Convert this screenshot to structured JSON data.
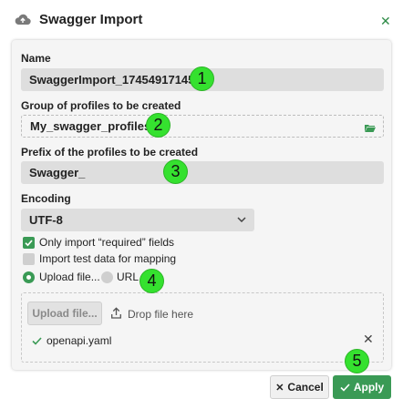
{
  "dialog": {
    "title": "Swagger Import",
    "close_icon": "close-icon",
    "title_icon": "cloud-upload-icon"
  },
  "form": {
    "name": {
      "label": "Name",
      "value": "SwaggerImport_1745491714574"
    },
    "group": {
      "label": "Group of profiles to be created",
      "value": "My_swagger_profiles",
      "icon": "folder-open-icon"
    },
    "prefix": {
      "label": "Prefix of the profiles to be created",
      "value": "Swagger_"
    },
    "encoding": {
      "label": "Encoding",
      "value": "UTF-8",
      "icon": "chevron-down-icon"
    },
    "only_required": {
      "label": "Only import “required” fields",
      "checked": true
    },
    "import_test_data": {
      "label": "Import test data for mapping",
      "checked": false
    },
    "source": {
      "options": [
        {
          "label": "Upload file...",
          "selected": true
        },
        {
          "label": "URL",
          "selected": false
        }
      ]
    },
    "upload": {
      "button_label": "Upload file...",
      "drop_text": "Drop file here",
      "file_name": "openapi.yaml",
      "remove_icon": "close-icon"
    }
  },
  "badges": [
    "1",
    "2",
    "3",
    "4",
    "5"
  ],
  "footer": {
    "cancel_label": "Cancel",
    "apply_label": "Apply"
  },
  "colors": {
    "accent": "#3a9a55",
    "badge": "#35e12f",
    "field_bg": "#dedede",
    "panel_bg": "#f5f5f5"
  }
}
